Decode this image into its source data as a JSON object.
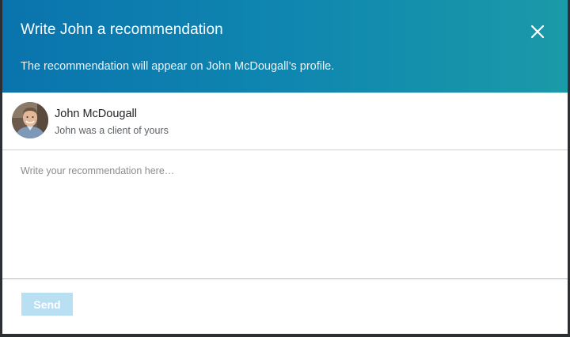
{
  "dialog": {
    "title": "Write John a recommendation",
    "subtitle": "The recommendation will appear on John McDougall’s profile.",
    "close_icon": "close-icon"
  },
  "recipient": {
    "name": "John McDougall",
    "relation": "John was a client of yours",
    "avatar_icon": "avatar"
  },
  "editor": {
    "value": "",
    "placeholder": "Write your recommendation here…"
  },
  "footer": {
    "send_label": "Send",
    "send_enabled": false
  },
  "colors": {
    "header_start": "#0a74ad",
    "header_end": "#1b9aa8",
    "send_disabled": "#b9dff3"
  }
}
